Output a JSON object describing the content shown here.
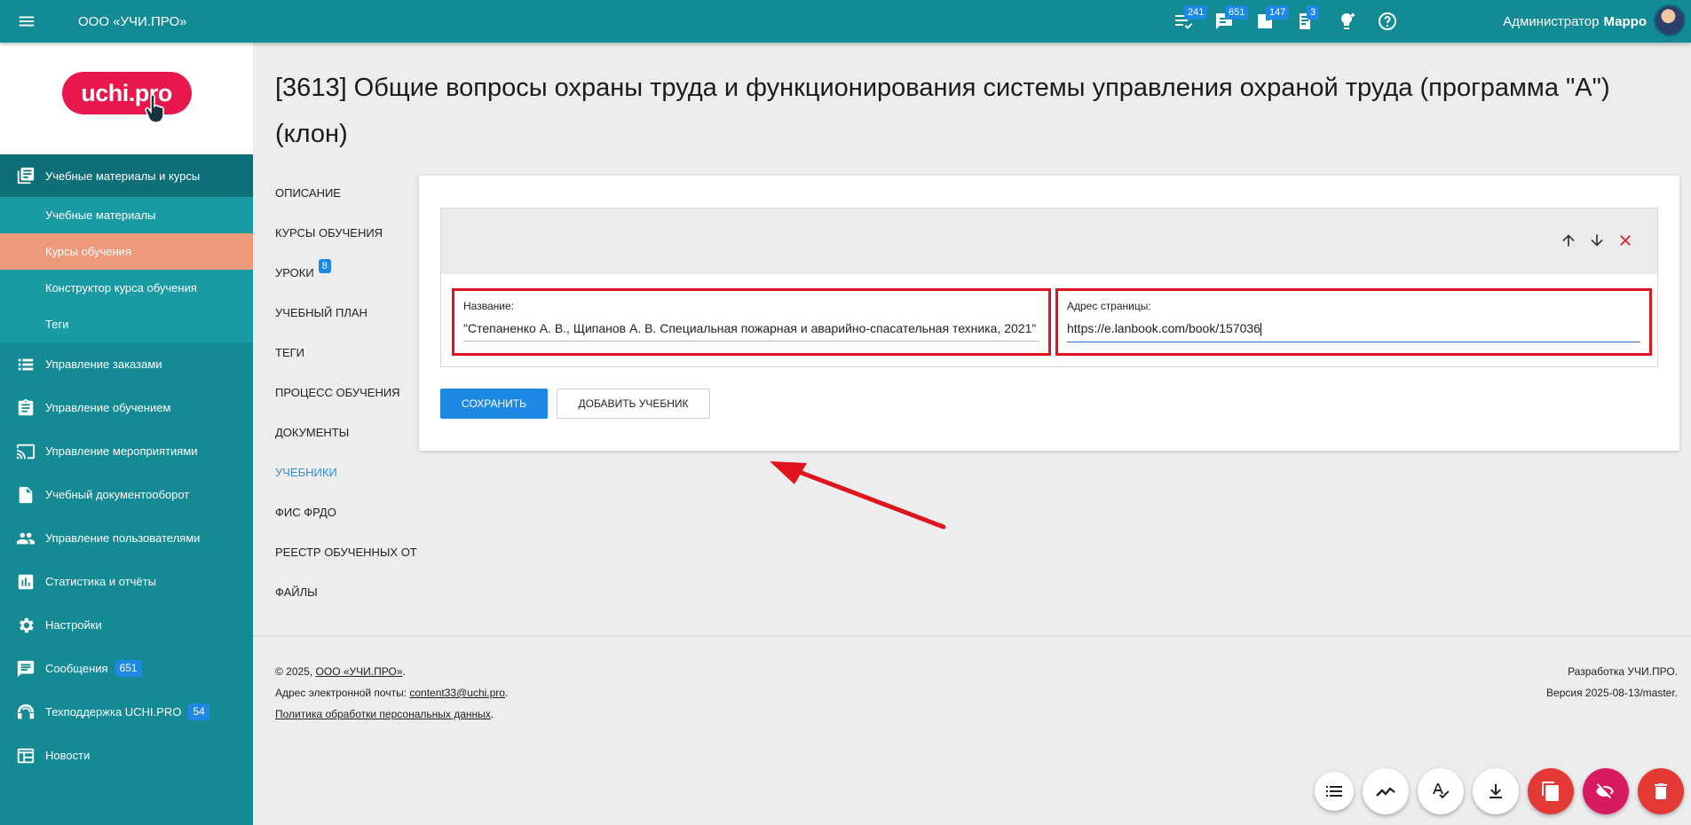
{
  "topbar": {
    "org": "ООО «УЧИ.ПРО»",
    "badges": [
      {
        "icon": "tasks-list-icon",
        "count": "241"
      },
      {
        "icon": "messages-icon",
        "count": "651"
      },
      {
        "icon": "support-tickets-icon",
        "count": "147"
      },
      {
        "icon": "documents-icon",
        "count": "3"
      },
      {
        "icon": "lightbulb-icon",
        "count": ""
      },
      {
        "icon": "help-icon",
        "count": ""
      }
    ],
    "user_role": "Администратор",
    "user_name": "Марро"
  },
  "sidebar": {
    "logo_text": "uchi.pro",
    "items": [
      {
        "label": "Учебные материалы и курсы",
        "icon": "library-books-icon"
      },
      {
        "label": "Учебные материалы"
      },
      {
        "label": "Курсы обучения"
      },
      {
        "label": "Конструктор курса обучения"
      },
      {
        "label": "Теги"
      },
      {
        "label": "Управление заказами",
        "icon": "orders-list-icon"
      },
      {
        "label": "Управление обучением",
        "icon": "clipboard-icon"
      },
      {
        "label": "Управление мероприятиями",
        "icon": "cast-icon"
      },
      {
        "label": "Учебный документооборот",
        "icon": "document-icon"
      },
      {
        "label": "Управление пользователями",
        "icon": "people-icon"
      },
      {
        "label": "Статистика и отчёты",
        "icon": "chart-icon"
      },
      {
        "label": "Настройки",
        "icon": "gear-icon"
      },
      {
        "label": "Сообщения",
        "icon": "message-icon",
        "badge": "651"
      },
      {
        "label": "Техподдержка UCHI.PRO",
        "icon": "support-icon",
        "badge": "54"
      },
      {
        "label": "Новости",
        "icon": "news-icon"
      }
    ]
  },
  "page": {
    "title": "[3613] Общие вопросы охраны труда и функционирования системы управления охраной труда (программа \"А\") (клон)"
  },
  "subnav": [
    {
      "label": "Описание"
    },
    {
      "label": "Курсы обучения"
    },
    {
      "label": "Уроки",
      "badge": "8"
    },
    {
      "label": "Учебный план"
    },
    {
      "label": "Теги"
    },
    {
      "label": "Процесс обучения"
    },
    {
      "label": "Документы"
    },
    {
      "label": "Учебники"
    },
    {
      "label": "ФИС ФРДО"
    },
    {
      "label": "Реестр обученных ОТ"
    },
    {
      "label": "Файлы"
    }
  ],
  "form": {
    "name_label": "Название:",
    "name_value": "\"Степаненко А. В., Щипанов А. В. Специальная пожарная и аварийно-спасательная техника, 2021\"",
    "url_label": "Адрес страницы:",
    "url_value": "https://e.lanbook.com/book/157036",
    "save_button": "Сохранить",
    "add_button": "Добавить учебник"
  },
  "footer": {
    "copyright_prefix": "©  2025, ",
    "copyright_org": "ООО «УЧИ.ПРО»",
    "copyright_suffix": ".",
    "email_label": "Адрес электронной почты: ",
    "email": "content33@uchi.pro",
    "email_suffix": ".",
    "privacy": "Политика обработки персональных данных",
    "privacy_suffix": ".",
    "developer": "Разработка УЧИ.ПРО.",
    "version": "Версия 2025-08-13/master."
  },
  "fabs": [
    "list-icon",
    "trend-icon",
    "spellcheck-icon",
    "download-icon",
    "copy-icon",
    "hide-icon",
    "delete-icon"
  ],
  "colors": {
    "topbar": "#128b95",
    "sidebar": "#138a94",
    "accent": "#1e88e5",
    "selected": "#ee9a7a",
    "highlight": "#e0141e"
  }
}
